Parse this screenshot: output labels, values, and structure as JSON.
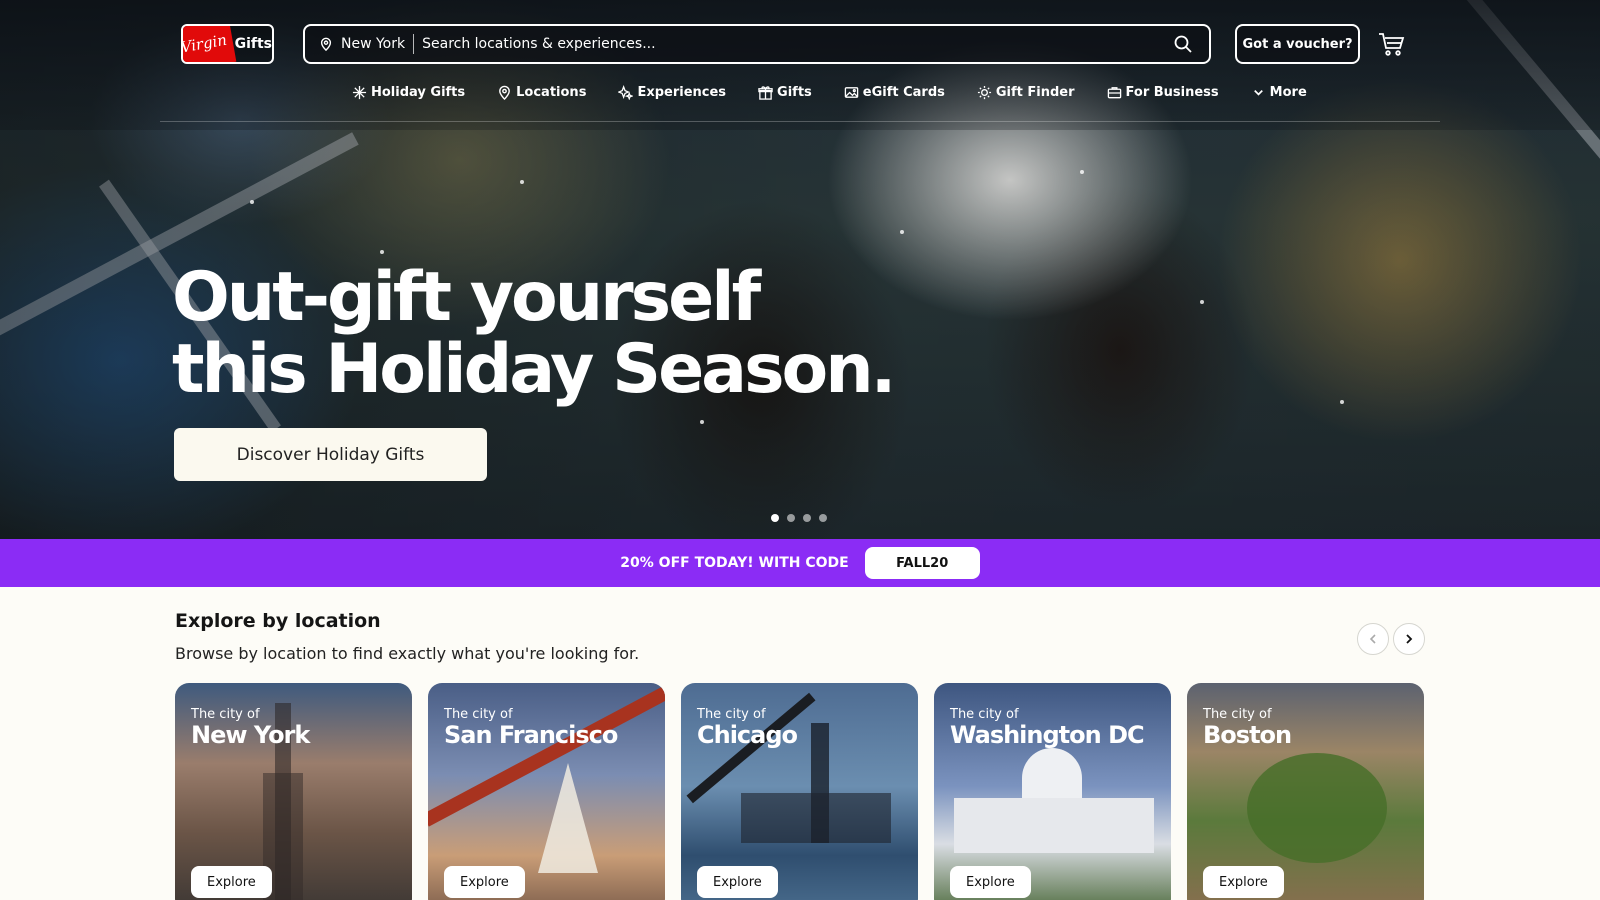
{
  "header": {
    "logo_brand": "Virgin",
    "logo_label": "Gifts",
    "search_location": "New York",
    "search_placeholder": "Search locations & experiences...",
    "voucher_label": "Got a voucher?"
  },
  "nav": {
    "items": [
      {
        "label": "Holiday Gifts",
        "icon": "snowflake-icon"
      },
      {
        "label": "Locations",
        "icon": "location-pin-icon"
      },
      {
        "label": "Experiences",
        "icon": "sparkle-icon"
      },
      {
        "label": "Gifts",
        "icon": "gift-icon"
      },
      {
        "label": "eGift Cards",
        "icon": "card-image-icon"
      },
      {
        "label": "Gift Finder",
        "icon": "sun-icon"
      },
      {
        "label": "For Business",
        "icon": "briefcase-icon"
      },
      {
        "label": "More",
        "icon": "chevron-down-icon"
      }
    ]
  },
  "hero": {
    "headline_line1": "Out-gift yourself",
    "headline_line2": "this Holiday Season.",
    "cta_label": "Discover Holiday Gifts",
    "slide_count": 4,
    "active_slide": 1
  },
  "promo": {
    "text": "20% OFF TODAY! WITH CODE",
    "code": "FALL20",
    "color": "#8b2cf5"
  },
  "explore": {
    "title": "Explore by location",
    "subtitle": "Browse by location to find exactly what you're looking for.",
    "cards": [
      {
        "prefix": "The city of",
        "city": "New York",
        "button": "Explore"
      },
      {
        "prefix": "The city of",
        "city": "San Francisco",
        "button": "Explore"
      },
      {
        "prefix": "The city of",
        "city": "Chicago",
        "button": "Explore"
      },
      {
        "prefix": "The city of",
        "city": "Washington DC",
        "button": "Explore"
      },
      {
        "prefix": "The city of",
        "city": "Boston",
        "button": "Explore"
      }
    ]
  }
}
